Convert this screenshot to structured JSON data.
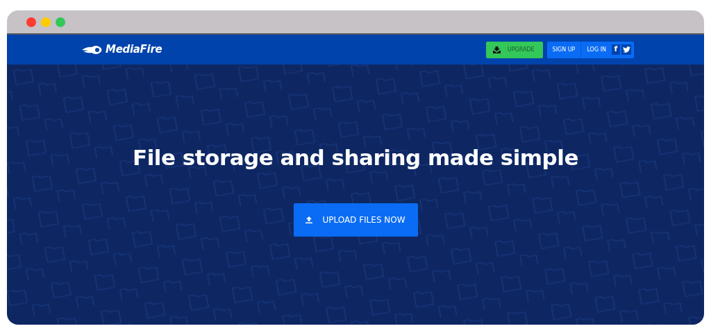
{
  "window": {
    "controls": [
      {
        "kind": "close"
      },
      {
        "kind": "minimize"
      },
      {
        "kind": "zoom"
      }
    ]
  },
  "navbar": {
    "logo": "MediaFire",
    "buttons": [
      {
        "kind": "upgrade",
        "label": "UPGRADE"
      },
      {
        "kind": "plain",
        "label": "SIGN UP"
      },
      {
        "kind": "plain",
        "label": "LOG IN"
      }
    ],
    "social": [
      {
        "kind": "facebook",
        "glyph": "f"
      },
      {
        "kind": "twitter"
      }
    ]
  },
  "hero": {
    "heading": "File storage and sharing made simple",
    "button": "UPLOAD FILES NOW"
  }
}
